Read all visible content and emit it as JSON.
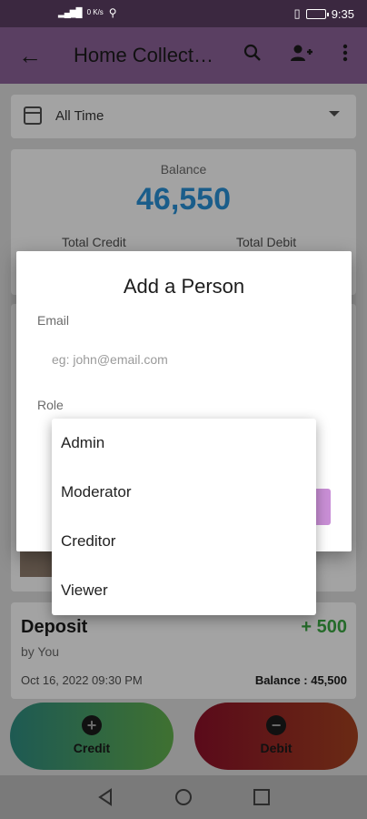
{
  "status_bar": {
    "signal": "📶",
    "data_speed": "0 K/s",
    "vibrate_icon": "vibrate-icon",
    "time": "9:35"
  },
  "app_bar": {
    "back_icon": "arrow-back-icon",
    "title": "Home Collect…",
    "search_icon": "search-icon",
    "add_person_icon": "person-add-icon",
    "more_icon": "more-vert-icon"
  },
  "filter": {
    "value": "All Time"
  },
  "balance": {
    "label": "Balance",
    "amount": "46,550",
    "total_credit_label": "Total Credit",
    "total_debit_label": "Total Debit"
  },
  "dialog": {
    "title": "Add a Person",
    "email_label": "Email",
    "email_placeholder": "eg: john@email.com",
    "role_label": "Role"
  },
  "role_options": [
    "Admin",
    "Moderator",
    "Creditor",
    "Viewer"
  ],
  "transaction": {
    "type": "Deposit",
    "amount": "+ 500",
    "by": "by You",
    "date": "Oct 16, 2022 09:30 PM",
    "balance": "Balance : 45,500"
  },
  "actions": {
    "credit_label": "Credit",
    "debit_label": "Debit"
  },
  "colors": {
    "app_bar": "#5a3f62",
    "balance_amount": "#1a5d8a",
    "deposit_amount": "#256b2a",
    "submit_button": "#c98fd6"
  }
}
